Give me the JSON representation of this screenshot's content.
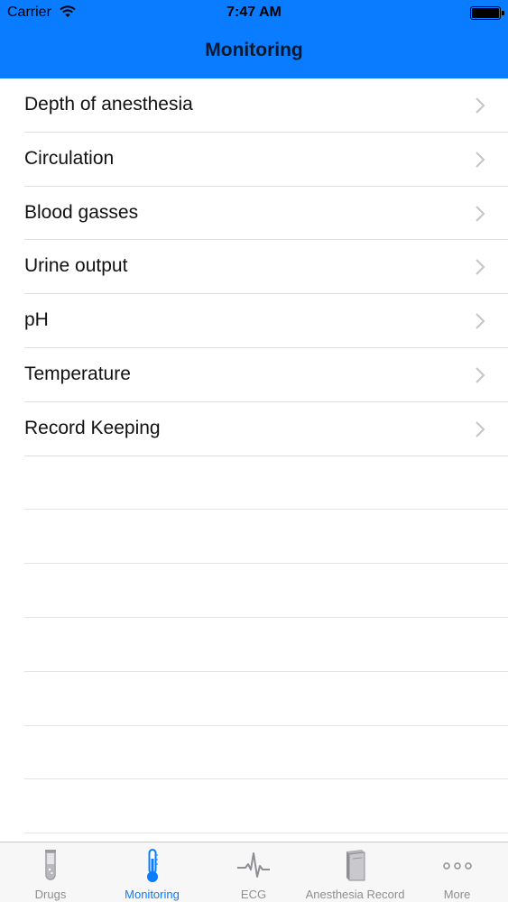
{
  "status_bar": {
    "carrier": "Carrier",
    "time": "7:47 AM"
  },
  "nav": {
    "title": "Monitoring"
  },
  "list": {
    "items": [
      {
        "label": "Depth of anesthesia"
      },
      {
        "label": "Circulation"
      },
      {
        "label": "Blood gasses"
      },
      {
        "label": "Urine output"
      },
      {
        "label": "pH"
      },
      {
        "label": "Temperature"
      },
      {
        "label": "Record Keeping"
      }
    ]
  },
  "tabbar": {
    "tabs": [
      {
        "label": "Drugs",
        "icon": "test-tube-icon"
      },
      {
        "label": "Monitoring",
        "icon": "thermometer-icon",
        "active": true
      },
      {
        "label": "ECG",
        "icon": "ecg-waveform-icon"
      },
      {
        "label": "Anesthesia Record",
        "icon": "book-icon"
      },
      {
        "label": "More",
        "icon": "more-dots-icon"
      }
    ]
  },
  "colors": {
    "accent": "#0a7cff",
    "separator": "#dcdce0",
    "inactive": "#8e8e93"
  }
}
